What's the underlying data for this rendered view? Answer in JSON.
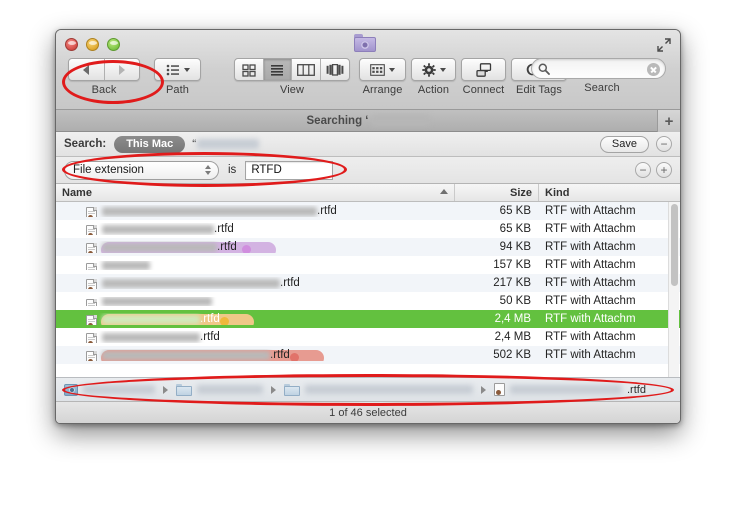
{
  "window": {
    "title_prefix": "Searching ‘",
    "smart_folder_icon": "smart-folder-icon"
  },
  "toolbar": {
    "back_forward_label": "Back",
    "path_label": "Path",
    "view_label": "View",
    "arrange_label": "Arrange",
    "action_label": "Action",
    "connect_label": "Connect",
    "edit_tags_label": "Edit Tags",
    "search_label": "Search",
    "search_value": "",
    "search_placeholder": ""
  },
  "scope": {
    "label": "Search:",
    "this_mac": "This Mac",
    "quote": "“",
    "save_label": "Save",
    "remove_label": "−"
  },
  "criteria": {
    "attribute": "File extension",
    "operator": "is",
    "value": "RTFD",
    "minus_label": "−",
    "plus_label": "+",
    "tab_plus_label": "+"
  },
  "columns": {
    "name": "Name",
    "size": "Size",
    "kind": "Kind"
  },
  "rows": [
    {
      "ext": ".rtfd",
      "size": "65 KB",
      "kind": "RTF with Attachm",
      "tag": null,
      "tagdot": null,
      "selected": false,
      "namewidth": 215,
      "blurwidth": 215
    },
    {
      "ext": ".rtfd",
      "size": "65 KB",
      "kind": "RTF with Attachm",
      "tag": null,
      "tagdot": null,
      "selected": false,
      "namewidth": 112,
      "blurwidth": 112
    },
    {
      "ext": ".rtfd",
      "size": "94 KB",
      "kind": "RTF with Attachm",
      "tag": "#d3b3e2",
      "tagdot": "#d08ede",
      "selected": false,
      "namewidth": 120,
      "blurwidth": 115
    },
    {
      "ext": "",
      "size": "157 KB",
      "kind": "RTF with Attachm",
      "tag": null,
      "tagdot": null,
      "selected": false,
      "namewidth": 48,
      "blurwidth": 48
    },
    {
      "ext": ".rtfd",
      "size": "217 KB",
      "kind": "RTF with Attachm",
      "tag": null,
      "tagdot": null,
      "selected": false,
      "namewidth": 178,
      "blurwidth": 178
    },
    {
      "ext": "",
      "size": "50 KB",
      "kind": "RTF with Attachm",
      "tag": null,
      "tagdot": null,
      "selected": false,
      "namewidth": 110,
      "blurwidth": 110
    },
    {
      "ext": ".rtfd",
      "size": "2,4 MB",
      "kind": "RTF with Attachm",
      "tag": "#efc888",
      "tagdot": "#f0b83c",
      "selected": true,
      "namewidth": 98,
      "blurwidth": 98
    },
    {
      "ext": ".rtfd",
      "size": "2,4 MB",
      "kind": "RTF with Attachm",
      "tag": null,
      "tagdot": null,
      "selected": false,
      "namewidth": 98,
      "blurwidth": 98
    },
    {
      "ext": ".rtfd",
      "size": "502 KB",
      "kind": "RTF with Attachm",
      "tag": "#e79b91",
      "tagdot": "#e1736a",
      "selected": false,
      "namewidth": 168,
      "blurwidth": 168
    }
  ],
  "pathbar": {
    "final_ext": ".rtfd"
  },
  "status": {
    "text": "1 of 46 selected"
  },
  "colors": {
    "selection_green": "#63c13f",
    "tag_purple": "#d3b3e2",
    "tag_orange": "#efc888",
    "tag_red": "#e79b91",
    "annotation_red": "#e01b1b"
  }
}
